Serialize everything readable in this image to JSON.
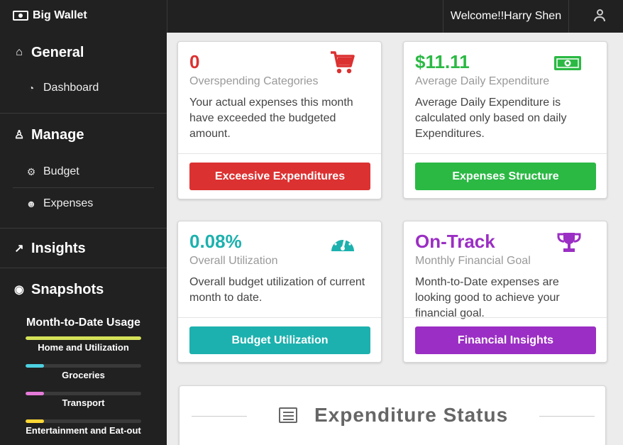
{
  "brand": {
    "name": "Big Wallet"
  },
  "user": {
    "welcome": "Welcome!!Harry Shen"
  },
  "sidebar": {
    "general": {
      "title": "General",
      "items": [
        {
          "label": "Dashboard"
        }
      ]
    },
    "manage": {
      "title": "Manage",
      "items": [
        {
          "label": "Budget"
        },
        {
          "label": "Expenses"
        }
      ]
    },
    "insights": {
      "title": "Insights"
    },
    "snapshots": {
      "title": "Snapshots"
    },
    "usage": {
      "title": "Month-to-Date Usage",
      "items": [
        {
          "label": "Home and Utilization",
          "fraction": 1.0,
          "color": "#d4e157"
        },
        {
          "label": "Groceries",
          "fraction": 0.16,
          "color": "#4dd0e1"
        },
        {
          "label": "Transport",
          "fraction": 0.16,
          "color": "#e57bd8"
        },
        {
          "label": "Entertainment and Eat-out",
          "fraction": 0.16,
          "color": "#fdd835"
        }
      ]
    }
  },
  "cards": [
    {
      "value": "0",
      "subtitle": "Overspending Categories",
      "desc": "Your actual expenses this month have exceeded the budgeted amount.",
      "button": "Exceesive Expenditures",
      "color": "#dc3131",
      "icon": "cart-icon"
    },
    {
      "value": "$11.11",
      "subtitle": "Average Daily Expenditure",
      "desc": "Average Daily Expenditure is calculated only based on daily Expenditures.",
      "button": "Expenses Structure",
      "color": "#2bb944",
      "icon": "money-icon"
    },
    {
      "value": "0.08%",
      "subtitle": "Overall Utilization",
      "desc": "Overall budget utilization of current month to date.",
      "button": "Budget Utilization",
      "color": "#1cb1ae",
      "icon": "gauge-icon"
    },
    {
      "value": "On-Track",
      "subtitle": "Monthly Financial Goal",
      "desc": "Month-to-Date expenses are looking good to achieve your financial goal.",
      "button": "Financial Insights",
      "color": "#9b2ec4",
      "icon": "trophy-icon"
    }
  ],
  "status": {
    "title": "Expenditure Status"
  }
}
